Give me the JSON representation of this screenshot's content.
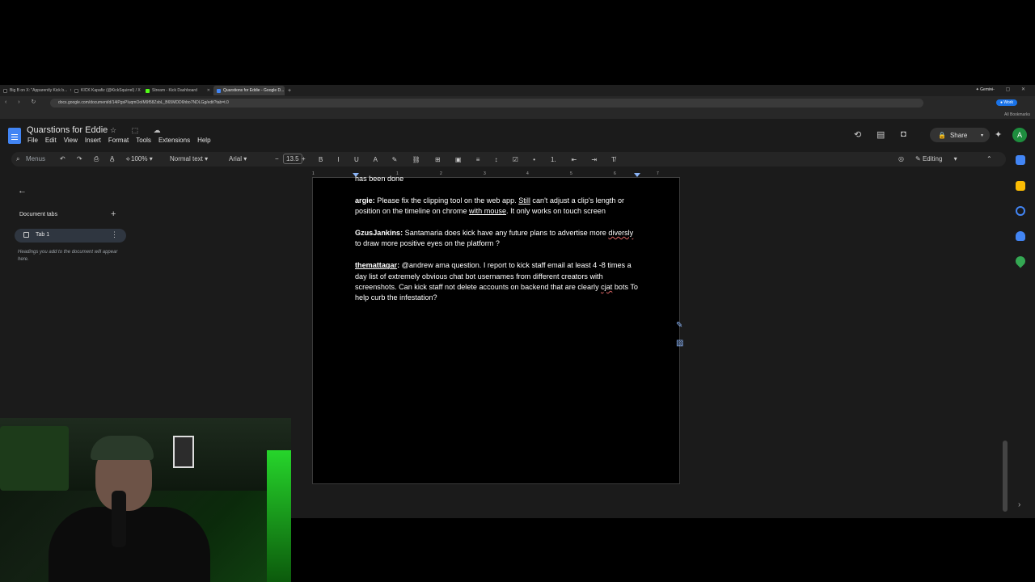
{
  "browser": {
    "tabs": [
      {
        "title": "Big B on X: \"Apparently Kick b...",
        "color": "#111111",
        "active": false
      },
      {
        "title": "KICK Kapafiz (@KickSquirrel) / X",
        "color": "#111111",
        "active": false
      },
      {
        "title": "Stream - Kick Dashboard",
        "color": "#53fc18",
        "active": false
      },
      {
        "title": "Quarstions for Eddie - Google D...",
        "color": "#4285f4",
        "active": true
      }
    ],
    "new_tab": "+",
    "gemini_label": "✦ Gemini",
    "window_controls": "— ▢ ✕",
    "url": "docs.google.com/document/d/14iPgsPIuqmOoIM9f58ZsbL_B65MDD6hbo7NDLGg/edit?tab=t.0",
    "work_label": "● Work",
    "nav_icons": "‹ › ↻",
    "all_bookmarks": "All Bookmarks"
  },
  "doc": {
    "title": "Quarstions for Eddie",
    "title_icons": "☆ ⬚ ☁",
    "menu": [
      "File",
      "Edit",
      "View",
      "Insert",
      "Format",
      "Tools",
      "Extensions",
      "Help"
    ],
    "share_label": "Share",
    "avatar_letter": "A",
    "history_icon": "⟲",
    "comment_icon": "▤",
    "meet_icon": "◘",
    "gemini_icon": "✦"
  },
  "toolbar": {
    "menus_label": "Menus",
    "zoom": "100%",
    "style": "Normal text",
    "font": "Arial",
    "font_size": "13.5",
    "mode": "Editing",
    "icons_left": "↶ ↷ ⎙ A̲ ⟡",
    "icons_format": "B I U A ✎ ⛓ ⊞ ▣ ≡ ↕ ☑ • ⒈ ⇤ ⇥ T̸",
    "font_size_minus": "−",
    "font_size_plus": "+"
  },
  "ruler": [
    "1",
    "1",
    "2",
    "3",
    "4",
    "5",
    "6",
    "7"
  ],
  "sidebar": {
    "back": "←",
    "heading": "Document tabs",
    "add": "+",
    "tab_label": "Tab 1",
    "tab_menu": "⋮",
    "hint": "Headings you add to the document will appear here."
  },
  "document_body": {
    "p0": "has been done",
    "p1_user": "argie:",
    "p1_a": " Please fix the clipping tool on the web app. ",
    "p1_b": "Still",
    "p1_c": " can't adjust a clip's length or position on the timeline on chrome ",
    "p1_d": "with mouse",
    "p1_e": ". It only works on touch screen",
    "p2_user": "GzusJankins:",
    "p2_a": " Santamaria does kick have any future plans to advertise more ",
    "p2_b": "diversly",
    "p2_c": " to draw more positive eyes on the platform ?",
    "p3_user": "themattagar",
    "p3_colon": ":",
    "p3_a": " @andrew ama question. I report to kick staff email at least 4 -8 times a day list of extremely obvious chat bot usernames from different creators with screenshots. Can kick staff not delete accounts on backend that are clearly ",
    "p3_b": "cjat",
    "p3_c": " bots To help curb the infestation?"
  },
  "edit_icons": [
    "✎",
    "▨"
  ],
  "right_rail_colors": [
    "#4285f4",
    "#fbbc04",
    "#4285f4",
    "#4285f4",
    "#34a853"
  ],
  "right_rail_chevron": "›"
}
